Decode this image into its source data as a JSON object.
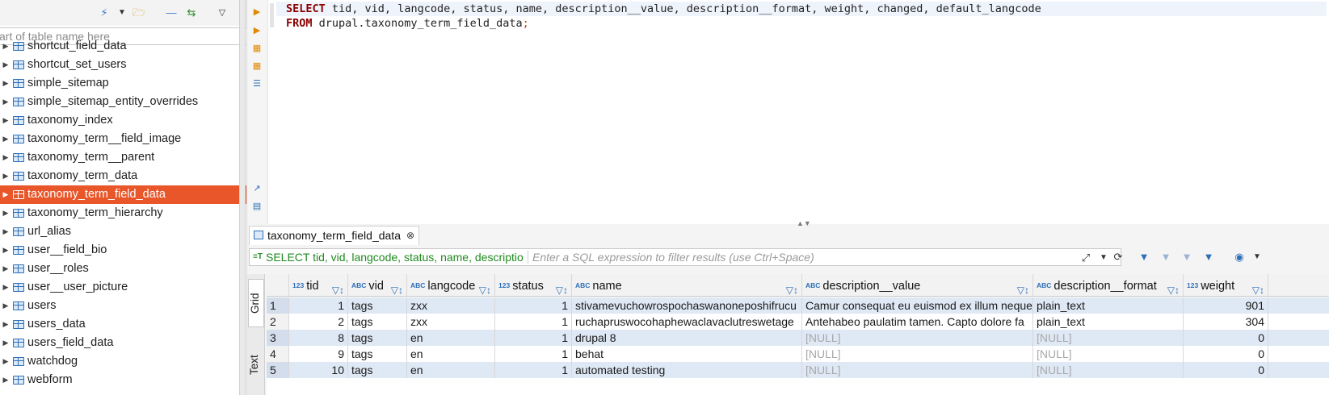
{
  "navigator": {
    "filter_placeholder": "art of table name here",
    "toolbar_icons": [
      "connect-icon",
      "dropdown-icon",
      "folder-icon",
      "minus-icon",
      "link-icon",
      "menu-icon"
    ],
    "items": [
      {
        "label": "shortcut_field_data",
        "selected": false
      },
      {
        "label": "shortcut_set_users",
        "selected": false
      },
      {
        "label": "simple_sitemap",
        "selected": false
      },
      {
        "label": "simple_sitemap_entity_overrides",
        "selected": false
      },
      {
        "label": "taxonomy_index",
        "selected": false
      },
      {
        "label": "taxonomy_term__field_image",
        "selected": false
      },
      {
        "label": "taxonomy_term__parent",
        "selected": false
      },
      {
        "label": "taxonomy_term_data",
        "selected": false
      },
      {
        "label": "taxonomy_term_field_data",
        "selected": true
      },
      {
        "label": "taxonomy_term_hierarchy",
        "selected": false
      },
      {
        "label": "url_alias",
        "selected": false
      },
      {
        "label": "user__field_bio",
        "selected": false
      },
      {
        "label": "user__roles",
        "selected": false
      },
      {
        "label": "user__user_picture",
        "selected": false
      },
      {
        "label": "users",
        "selected": false
      },
      {
        "label": "users_data",
        "selected": false
      },
      {
        "label": "users_field_data",
        "selected": false
      },
      {
        "label": "watchdog",
        "selected": false
      },
      {
        "label": "webform",
        "selected": false
      }
    ]
  },
  "editor": {
    "line1_kw": "SELECT",
    "line1_rest": " tid, vid, langcode, status, name, description__value, description__format, weight, changed, default_langcode",
    "line2_kw": "FROM",
    "line2_rest": " drupal.taxonomy_term_field_data",
    "line2_end": ";"
  },
  "results": {
    "tab_label": "taxonomy_term_field_data",
    "query_text": "SELECT tid, vid, langcode, status, name, descriptio",
    "filter_placeholder": "Enter a SQL expression to filter results (use Ctrl+Space)",
    "side_tabs": {
      "grid": "Grid",
      "text": "Text"
    },
    "columns": [
      {
        "type": "123",
        "name": "tid"
      },
      {
        "type": "ABC",
        "name": "vid"
      },
      {
        "type": "ABC",
        "name": "langcode"
      },
      {
        "type": "123",
        "name": "status"
      },
      {
        "type": "ABC",
        "name": "name"
      },
      {
        "type": "ABC",
        "name": "description__value"
      },
      {
        "type": "ABC",
        "name": "description__format"
      },
      {
        "type": "123",
        "name": "weight"
      }
    ],
    "rows": [
      {
        "n": "1",
        "tid": "1",
        "vid": "tags",
        "langcode": "zxx",
        "status": "1",
        "name": "stivamevuchowrospochaswanoneposhifrucu",
        "desc_value": "Camur consequat eu euismod ex illum neque",
        "desc_format": "plain_text",
        "weight": "901"
      },
      {
        "n": "2",
        "tid": "2",
        "vid": "tags",
        "langcode": "zxx",
        "status": "1",
        "name": "ruchapruswocohaphewaclavaclutreswetage",
        "desc_value": "Antehabeo paulatim tamen. Capto dolore fa",
        "desc_format": "plain_text",
        "weight": "304"
      },
      {
        "n": "3",
        "tid": "8",
        "vid": "tags",
        "langcode": "en",
        "status": "1",
        "name": "drupal 8",
        "desc_value": "[NULL]",
        "desc_format": "[NULL]",
        "weight": "0"
      },
      {
        "n": "4",
        "tid": "9",
        "vid": "tags",
        "langcode": "en",
        "status": "1",
        "name": "behat",
        "desc_value": "[NULL]",
        "desc_format": "[NULL]",
        "weight": "0"
      },
      {
        "n": "5",
        "tid": "10",
        "vid": "tags",
        "langcode": "en",
        "status": "1",
        "name": "automated testing",
        "desc_value": "[NULL]",
        "desc_format": "[NULL]",
        "weight": "0"
      }
    ]
  },
  "colors": {
    "selection": "#e8562a",
    "keyword": "#8b0000",
    "query": "#1f8a1f",
    "accent": "#2d6fb8"
  }
}
